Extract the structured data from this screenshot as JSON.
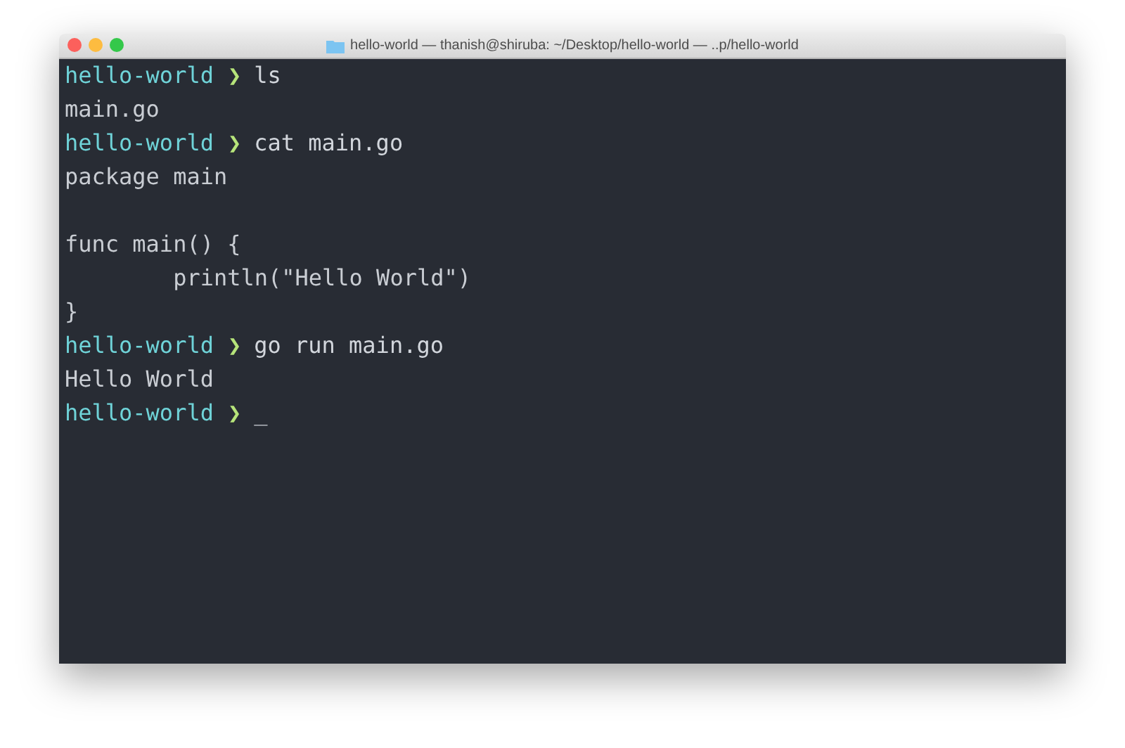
{
  "window": {
    "title": "hello-world — thanish@shiruba: ~/Desktop/hello-world — ..p/hello-world"
  },
  "terminal": {
    "lines": [
      {
        "kind": "prompt",
        "directory": "hello-world",
        "arrow": "❯",
        "command": "ls"
      },
      {
        "kind": "output",
        "text": "main.go"
      },
      {
        "kind": "prompt",
        "directory": "hello-world",
        "arrow": "❯",
        "command": "cat main.go"
      },
      {
        "kind": "output",
        "text": "package main"
      },
      {
        "kind": "blank"
      },
      {
        "kind": "output",
        "text": "func main() {"
      },
      {
        "kind": "output",
        "text": "        println(\"Hello World\")"
      },
      {
        "kind": "output",
        "text": "}"
      },
      {
        "kind": "prompt",
        "directory": "hello-world",
        "arrow": "❯",
        "command": "go run main.go"
      },
      {
        "kind": "output",
        "text": "Hello World"
      },
      {
        "kind": "prompt",
        "directory": "hello-world",
        "arrow": "❯",
        "cursor": "_"
      }
    ]
  }
}
